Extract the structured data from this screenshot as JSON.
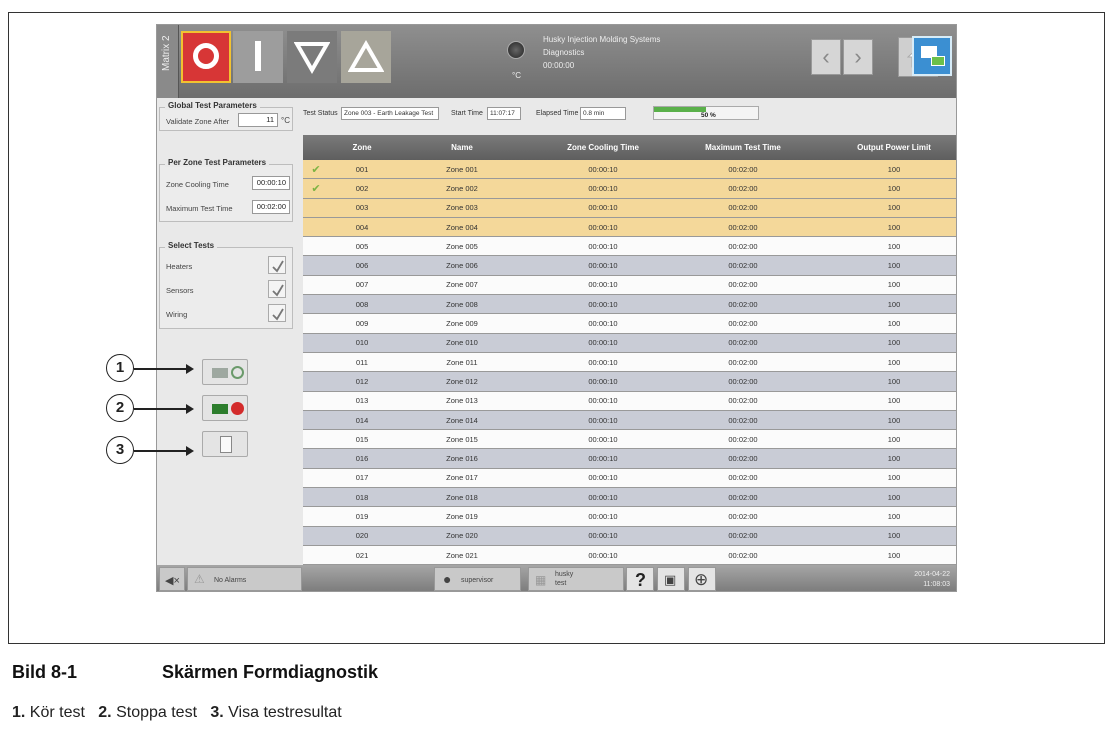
{
  "header": {
    "matrix_tab": "Matrix 2",
    "unit": "°C",
    "info_line1": "Husky Injection Molding Systems",
    "info_line2": "Diagnostics",
    "info_line3": "00:00:00"
  },
  "left_panel": {
    "global_title": "Global Test Parameters",
    "validate_label": "Validate Zone After",
    "validate_value": "11",
    "validate_unit": "°C",
    "per_zone_title": "Per Zone Test Parameters",
    "cooling_label": "Zone Cooling Time",
    "cooling_value": "00:00:10",
    "max_label": "Maximum Test Time",
    "max_value": "00:02:00",
    "select_title": "Select Tests",
    "tests": [
      {
        "label": "Heaters",
        "checked": true
      },
      {
        "label": "Sensors",
        "checked": true
      },
      {
        "label": "Wiring",
        "checked": true
      }
    ]
  },
  "status": {
    "test_status_label": "Test Status",
    "test_status_value": "Zone 003 - Earth Leakage Test",
    "start_label": "Start Time",
    "start_value": "11:07:17",
    "elapsed_label": "Elapsed Time",
    "elapsed_value": "0.8 min",
    "progress_text": "50 %",
    "progress_fraction": 0.5
  },
  "table": {
    "columns": [
      "Zone",
      "Name",
      "Zone Cooling Time",
      "Maximum Test Time",
      "Output Power Limit"
    ],
    "rows": [
      {
        "zone": "001",
        "name": "Zone 001",
        "cool": "00:00:10",
        "max": "00:02:00",
        "limit": "100",
        "state": "tested",
        "done": true
      },
      {
        "zone": "002",
        "name": "Zone 002",
        "cool": "00:00:10",
        "max": "00:02:00",
        "limit": "100",
        "state": "tested",
        "done": true
      },
      {
        "zone": "003",
        "name": "Zone 003",
        "cool": "00:00:10",
        "max": "00:02:00",
        "limit": "100",
        "state": "tested",
        "done": false
      },
      {
        "zone": "004",
        "name": "Zone 004",
        "cool": "00:00:10",
        "max": "00:02:00",
        "limit": "100",
        "state": "tested",
        "done": false
      },
      {
        "zone": "005",
        "name": "Zone 005",
        "cool": "00:00:10",
        "max": "00:02:00",
        "limit": "100",
        "state": "white",
        "done": false
      },
      {
        "zone": "006",
        "name": "Zone 006",
        "cool": "00:00:10",
        "max": "00:02:00",
        "limit": "100",
        "state": "alt",
        "done": false
      },
      {
        "zone": "007",
        "name": "Zone 007",
        "cool": "00:00:10",
        "max": "00:02:00",
        "limit": "100",
        "state": "white",
        "done": false
      },
      {
        "zone": "008",
        "name": "Zone 008",
        "cool": "00:00:10",
        "max": "00:02:00",
        "limit": "100",
        "state": "alt",
        "done": false
      },
      {
        "zone": "009",
        "name": "Zone 009",
        "cool": "00:00:10",
        "max": "00:02:00",
        "limit": "100",
        "state": "white",
        "done": false
      },
      {
        "zone": "010",
        "name": "Zone 010",
        "cool": "00:00:10",
        "max": "00:02:00",
        "limit": "100",
        "state": "alt",
        "done": false
      },
      {
        "zone": "011",
        "name": "Zone 011",
        "cool": "00:00:10",
        "max": "00:02:00",
        "limit": "100",
        "state": "white",
        "done": false
      },
      {
        "zone": "012",
        "name": "Zone 012",
        "cool": "00:00:10",
        "max": "00:02:00",
        "limit": "100",
        "state": "alt",
        "done": false
      },
      {
        "zone": "013",
        "name": "Zone 013",
        "cool": "00:00:10",
        "max": "00:02:00",
        "limit": "100",
        "state": "white",
        "done": false
      },
      {
        "zone": "014",
        "name": "Zone 014",
        "cool": "00:00:10",
        "max": "00:02:00",
        "limit": "100",
        "state": "alt",
        "done": false
      },
      {
        "zone": "015",
        "name": "Zone 015",
        "cool": "00:00:10",
        "max": "00:02:00",
        "limit": "100",
        "state": "white",
        "done": false
      },
      {
        "zone": "016",
        "name": "Zone 016",
        "cool": "00:00:10",
        "max": "00:02:00",
        "limit": "100",
        "state": "alt",
        "done": false
      },
      {
        "zone": "017",
        "name": "Zone 017",
        "cool": "00:00:10",
        "max": "00:02:00",
        "limit": "100",
        "state": "white",
        "done": false
      },
      {
        "zone": "018",
        "name": "Zone 018",
        "cool": "00:00:10",
        "max": "00:02:00",
        "limit": "100",
        "state": "alt",
        "done": false
      },
      {
        "zone": "019",
        "name": "Zone 019",
        "cool": "00:00:10",
        "max": "00:02:00",
        "limit": "100",
        "state": "white",
        "done": false
      },
      {
        "zone": "020",
        "name": "Zone 020",
        "cool": "00:00:10",
        "max": "00:02:00",
        "limit": "100",
        "state": "alt",
        "done": false
      },
      {
        "zone": "021",
        "name": "Zone 021",
        "cool": "00:00:10",
        "max": "00:02:00",
        "limit": "100",
        "state": "white",
        "done": false
      }
    ]
  },
  "footer": {
    "alarm_text": "No Alarms",
    "user_text": "supervisor",
    "mold_line1": "husky",
    "mold_line2": "test",
    "help": "?",
    "date": "2014-04-22",
    "time": "11:08:03"
  },
  "callouts": [
    "1",
    "2",
    "3"
  ],
  "caption": {
    "figure_number": "Bild 8-1",
    "figure_title": "Skärmen Formdiagnostik",
    "legend": [
      {
        "num": "1.",
        "text": "Kör test"
      },
      {
        "num": "2.",
        "text": "Stoppa test"
      },
      {
        "num": "3.",
        "text": "Visa testresultat"
      }
    ]
  },
  "colors": {
    "tested_row": "#f4d89a",
    "alt_row": "#c9ccd6",
    "check_green": "#7cb342",
    "stop_red": "#d73636"
  }
}
